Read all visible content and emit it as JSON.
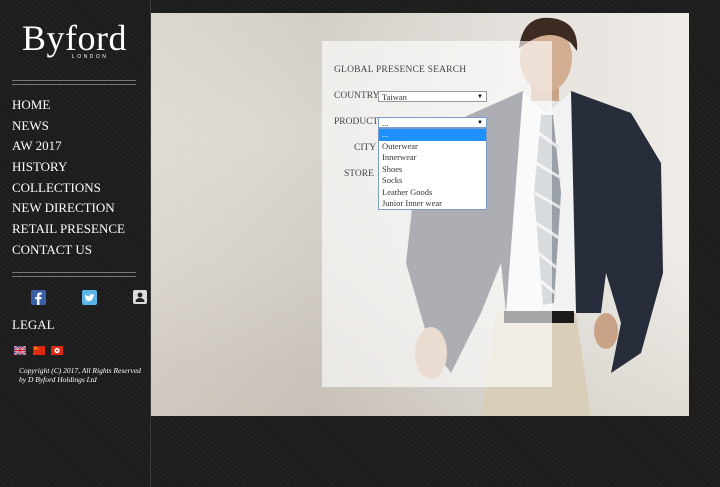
{
  "brand": {
    "logo_text": "Byford",
    "logo_subtext": "LONDON"
  },
  "nav": {
    "items": [
      {
        "label": "HOME"
      },
      {
        "label": "NEWS"
      },
      {
        "label": "AW 2017"
      },
      {
        "label": "HISTORY"
      },
      {
        "label": "COLLECTIONS"
      },
      {
        "label": "NEW DIRECTION"
      },
      {
        "label": "RETAIL PRESENCE"
      },
      {
        "label": "CONTACT US"
      }
    ]
  },
  "social": {
    "icons": [
      "facebook-icon",
      "twitter-icon",
      "user-icon"
    ]
  },
  "footer": {
    "legal_label": "LEGAL",
    "flags": [
      "uk-flag-icon",
      "china-flag-icon",
      "hong-kong-flag-icon"
    ],
    "copyright": "Copyright (C) 2017, All Rights Reserved by D Byford Holdings Ltd"
  },
  "search": {
    "title": "GLOBAL PRESENCE SEARCH",
    "country_label": "COUNTRY",
    "country_value": "Taiwan",
    "product_label": "PRODUCT",
    "product_value": "...",
    "city_label": "CITY",
    "store_label": "STORE",
    "product_options": [
      "...",
      "Outerwear",
      "Innerwear",
      "Shoes",
      "Socks",
      "Leather Goods",
      "Junior Inner wear"
    ],
    "selected_option_index": 0
  },
  "colors": {
    "background": "#1c1c1c",
    "highlight": "#1e90ff",
    "text_light": "#ffffff"
  }
}
